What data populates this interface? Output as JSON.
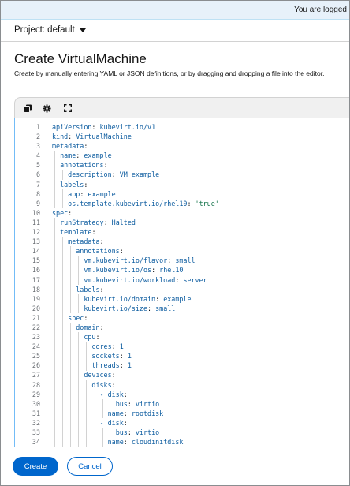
{
  "banner": {
    "text": "You are logged"
  },
  "project": {
    "label": "Project: default"
  },
  "page": {
    "title": "Create VirtualMachine",
    "description": "Create by manually entering YAML or JSON definitions, or by dragging and dropping a file into the editor."
  },
  "toolbar": {
    "icons": [
      "copy-icon",
      "settings-icon",
      "fullscreen-icon"
    ]
  },
  "editor": {
    "lines": [
      {
        "n": "1",
        "indent": 0,
        "key": "apiVersion",
        "value": "kubevirt.io/v1",
        "vtype": "v"
      },
      {
        "n": "2",
        "indent": 0,
        "key": "kind",
        "value": "VirtualMachine",
        "vtype": "v"
      },
      {
        "n": "3",
        "indent": 0,
        "key": "metadata",
        "value": "",
        "vtype": "v"
      },
      {
        "n": "4",
        "indent": 2,
        "key": "name",
        "value": "example",
        "vtype": "v"
      },
      {
        "n": "5",
        "indent": 2,
        "key": "annotations",
        "value": "",
        "vtype": "v"
      },
      {
        "n": "6",
        "indent": 4,
        "key": "description",
        "value": "VM example",
        "vtype": "v"
      },
      {
        "n": "7",
        "indent": 2,
        "key": "labels",
        "value": "",
        "vtype": "v"
      },
      {
        "n": "8",
        "indent": 4,
        "key": "app",
        "value": "example",
        "vtype": "v"
      },
      {
        "n": "9",
        "indent": 4,
        "key": "os.template.kubevirt.io/rhel10",
        "value": "'true'",
        "vtype": "s"
      },
      {
        "n": "10",
        "indent": 0,
        "key": "spec",
        "value": "",
        "vtype": "v"
      },
      {
        "n": "11",
        "indent": 2,
        "key": "runStrategy",
        "value": "Halted",
        "vtype": "v"
      },
      {
        "n": "12",
        "indent": 2,
        "key": "template",
        "value": "",
        "vtype": "v"
      },
      {
        "n": "13",
        "indent": 4,
        "key": "metadata",
        "value": "",
        "vtype": "v"
      },
      {
        "n": "14",
        "indent": 6,
        "key": "annotations",
        "value": "",
        "vtype": "v"
      },
      {
        "n": "15",
        "indent": 8,
        "key": "vm.kubevirt.io/flavor",
        "value": "small",
        "vtype": "v"
      },
      {
        "n": "16",
        "indent": 8,
        "key": "vm.kubevirt.io/os",
        "value": "rhel10",
        "vtype": "v"
      },
      {
        "n": "17",
        "indent": 8,
        "key": "vm.kubevirt.io/workload",
        "value": "server",
        "vtype": "v"
      },
      {
        "n": "18",
        "indent": 6,
        "key": "labels",
        "value": "",
        "vtype": "v"
      },
      {
        "n": "19",
        "indent": 8,
        "key": "kubevirt.io/domain",
        "value": "example",
        "vtype": "v"
      },
      {
        "n": "20",
        "indent": 8,
        "key": "kubevirt.io/size",
        "value": "small",
        "vtype": "v"
      },
      {
        "n": "21",
        "indent": 4,
        "key": "spec",
        "value": "",
        "vtype": "v"
      },
      {
        "n": "22",
        "indent": 6,
        "key": "domain",
        "value": "",
        "vtype": "v"
      },
      {
        "n": "23",
        "indent": 8,
        "key": "cpu",
        "value": "",
        "vtype": "v"
      },
      {
        "n": "24",
        "indent": 10,
        "key": "cores",
        "value": "1",
        "vtype": "v"
      },
      {
        "n": "25",
        "indent": 10,
        "key": "sockets",
        "value": "1",
        "vtype": "v"
      },
      {
        "n": "26",
        "indent": 10,
        "key": "threads",
        "value": "1",
        "vtype": "v"
      },
      {
        "n": "27",
        "indent": 8,
        "key": "devices",
        "value": "",
        "vtype": "v"
      },
      {
        "n": "28",
        "indent": 10,
        "key": "disks",
        "value": "",
        "vtype": "v"
      },
      {
        "n": "29",
        "indent": 12,
        "key": "- disk",
        "value": "",
        "vtype": "v"
      },
      {
        "n": "30",
        "indent": 16,
        "key": "bus",
        "value": "virtio",
        "vtype": "v"
      },
      {
        "n": "31",
        "indent": 14,
        "key": "name",
        "value": "rootdisk",
        "vtype": "v"
      },
      {
        "n": "32",
        "indent": 12,
        "key": "- disk",
        "value": "",
        "vtype": "v"
      },
      {
        "n": "33",
        "indent": 16,
        "key": "bus",
        "value": "virtio",
        "vtype": "v"
      },
      {
        "n": "34",
        "indent": 14,
        "key": "name",
        "value": "cloudinitdisk",
        "vtype": "v"
      }
    ]
  },
  "footer": {
    "create_label": "Create",
    "cancel_label": "Cancel"
  },
  "colors": {
    "primary": "#0066cc",
    "banner_bg": "#e7f1fa",
    "editor_border": "#73bcf7"
  }
}
